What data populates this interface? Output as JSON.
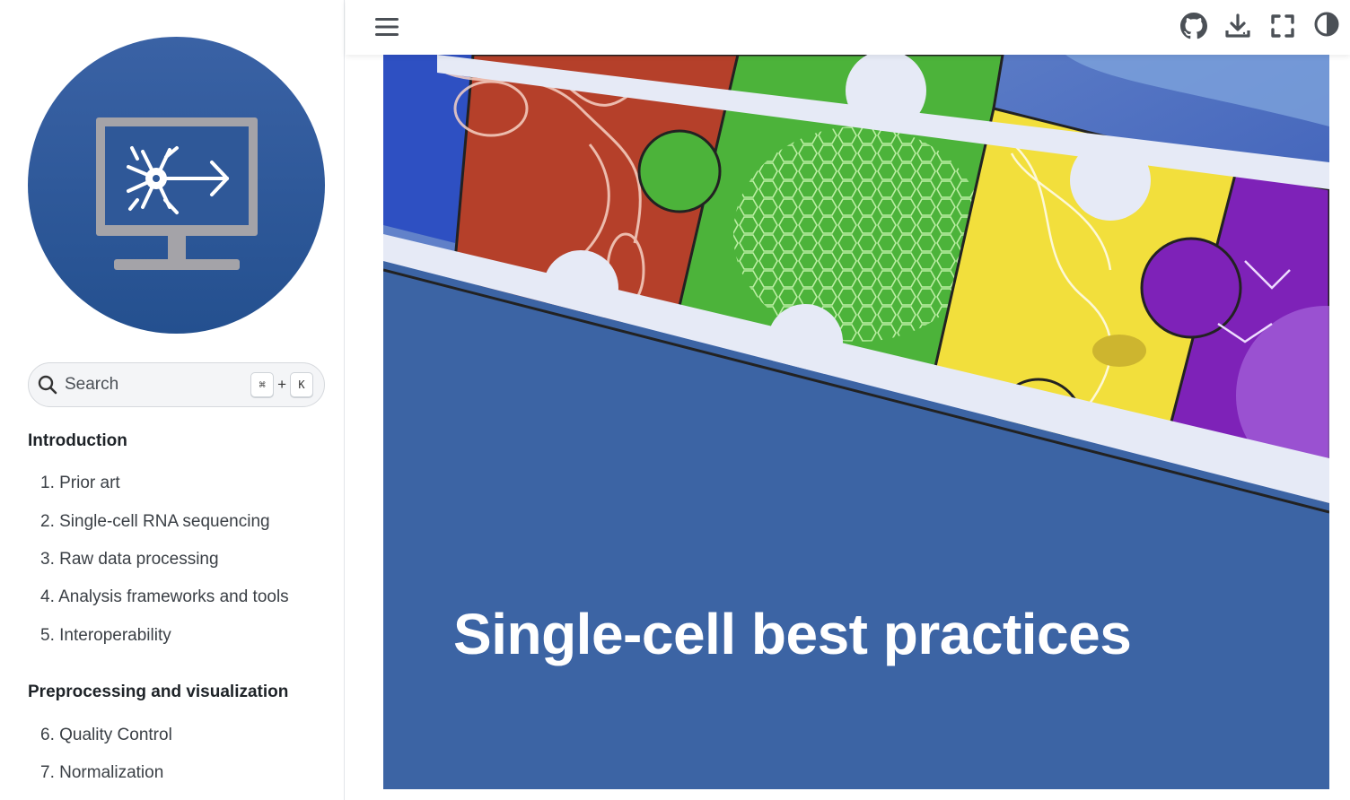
{
  "sidebar": {
    "logo_icon": "neuron-monitor-logo",
    "search": {
      "placeholder": "Search",
      "shortcut_key1": "⌘",
      "shortcut_plus": "+",
      "shortcut_key2": "K"
    },
    "sections": [
      {
        "caption": "Introduction",
        "items": [
          "1. Prior art",
          "2. Single-cell RNA sequencing",
          "3. Raw data processing",
          "4. Analysis frameworks and tools",
          "5. Interoperability"
        ]
      },
      {
        "caption": "Preprocessing and visualization",
        "items": [
          "6. Quality Control",
          "7. Normalization"
        ]
      }
    ]
  },
  "header": {
    "menu_icon": "hamburger-icon",
    "icons": [
      "github-icon",
      "download-icon",
      "fullscreen-icon",
      "theme-toggle-icon"
    ]
  },
  "hero": {
    "title": "Single-cell best practices",
    "colors": {
      "background": "#3c64a4",
      "red": "#b5402a",
      "green": "#4cb33a",
      "yellow": "#f2df3c",
      "purple": "#7e22b8"
    }
  }
}
